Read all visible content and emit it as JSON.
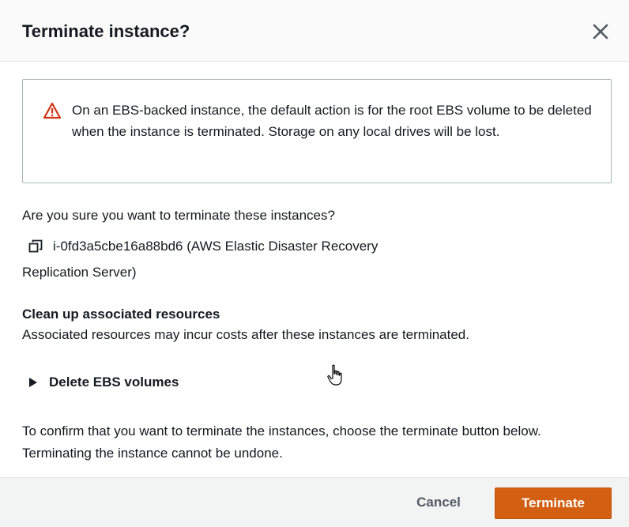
{
  "dialog": {
    "title": "Terminate instance?",
    "close_icon": "close-icon"
  },
  "alert": {
    "icon": "warning-triangle-icon",
    "text": "On an EBS-backed instance, the default action is for the root EBS volume to be deleted when the instance is terminated. Storage on any local drives will be lost."
  },
  "question": "Are you sure you want to terminate these instances?",
  "instance": {
    "icon": "copy-icon",
    "line1": "i-0fd3a5cbe16a88bd6 (AWS Elastic Disaster Recovery",
    "line2": "Replication Server)"
  },
  "cleanup": {
    "heading": "Clean up associated resources",
    "description": "Associated resources may incur costs after these instances are terminated."
  },
  "expander": {
    "icon": "caret-right-icon",
    "label": "Delete EBS volumes"
  },
  "confirm_text": "To confirm that you want to terminate the instances, choose the terminate button below. Terminating the instance cannot be undone.",
  "footer": {
    "cancel_label": "Cancel",
    "terminate_label": "Terminate"
  },
  "colors": {
    "primary_button": "#d35f12",
    "warning": "#d13212",
    "text": "#16191f",
    "secondary_text": "#545b64"
  }
}
